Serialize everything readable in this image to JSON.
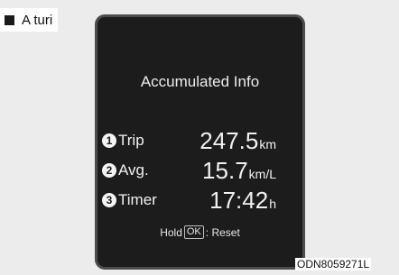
{
  "caption": {
    "text": "A turi"
  },
  "display": {
    "title": "Accumulated Info",
    "rows": [
      {
        "number": "1",
        "label": "Trip",
        "value": "247.5",
        "unit": "km"
      },
      {
        "number": "2",
        "label": "Avg.",
        "value": "15.7",
        "unit": "km/L"
      },
      {
        "number": "3",
        "label": "Timer",
        "value": "17:42",
        "unit": "h"
      }
    ],
    "hint": {
      "prefix": "Hold",
      "key": "OK",
      "suffix": ": Reset"
    }
  },
  "figure_code": "ODN8059271L"
}
